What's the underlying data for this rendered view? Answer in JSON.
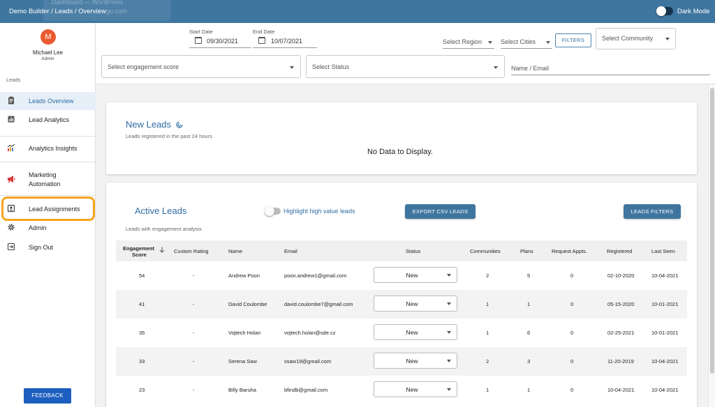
{
  "topbar": {
    "breadcrumb": "Demo Builder  /  Leads / Overview",
    "ghost_tab_title": "Dashboard — WordPress",
    "ghost_tab_url": "go.com",
    "dark_mode_label": "Dark Mode"
  },
  "user": {
    "initial": "M",
    "name": "Michael Lee",
    "role": "Admin"
  },
  "sidebar": {
    "section_label": "Leads",
    "items": [
      {
        "label": "Leads Overview",
        "icon": "clipboard-icon"
      },
      {
        "label": "Lead Analytics",
        "icon": "bar-chart-icon"
      },
      {
        "label": "Analytics Insights",
        "icon": "insights-chart-icon"
      },
      {
        "label": "Marketing",
        "label2": "Automation",
        "icon": "megaphone-icon"
      },
      {
        "label": "Lead Assignments",
        "icon": "assignment-icon"
      },
      {
        "label": "Admin",
        "icon": "gear-icon"
      },
      {
        "label": "Sign Out",
        "icon": "sign-out-icon"
      }
    ],
    "feedback_label": "FEEDBACK"
  },
  "filters": {
    "start_date_label": "Start Date",
    "start_date": "09/30/2021",
    "end_date_label": "End Date",
    "end_date": "10/07/2021",
    "region_placeholder": "Select Region",
    "cities_placeholder": "Select Cities",
    "filters_button": "FILTERS",
    "community_placeholder": "Select Community",
    "engagement_placeholder": "Select engagement score",
    "status_placeholder": "Select Status",
    "name_email_placeholder": "Name / Email"
  },
  "new_leads": {
    "title": "New Leads",
    "subtitle": "Leads registered in the past 24 hours",
    "empty_text": "No Data to Display."
  },
  "active_leads": {
    "title": "Active Leads",
    "subtitle": "Leads with engagement analysis",
    "highlight_label": "Highlight high value leads",
    "export_button": "EXPORT CSV LEADS",
    "filters_button": "LEADS FILTERS",
    "columns": {
      "engagement": "Engagement",
      "engagement2": "Score",
      "rating": "Custom Rating",
      "name": "Name",
      "email": "Email",
      "status": "Status",
      "communities": "Communities",
      "plans": "Plans",
      "appts": "Request Appts.",
      "registered": "Registered",
      "last_seen": "Last Seen"
    },
    "rows": [
      {
        "score": "54",
        "rating": "-",
        "name": "Andrew Poon",
        "email": "poon.andrew1@gmail.com",
        "status": "New",
        "communities": "2",
        "plans": "5",
        "appts": "0",
        "registered": "02-10-2020",
        "last_seen": "10-04-2021"
      },
      {
        "score": "41",
        "rating": "-",
        "name": "David Coulombe",
        "email": "david.coulombe7@gmail.com",
        "status": "New",
        "communities": "1",
        "plans": "1",
        "appts": "0",
        "registered": "05-15-2020",
        "last_seen": "10-01-2021"
      },
      {
        "score": "35",
        "rating": "-",
        "name": "Vojtech Holan",
        "email": "vojtech.holan@sde.cz",
        "status": "New",
        "communities": "1",
        "plans": "6",
        "appts": "0",
        "registered": "02-25-2021",
        "last_seen": "10-01-2021"
      },
      {
        "score": "33",
        "rating": "-",
        "name": "Serena Saw",
        "email": "ssaw19@gmail.com",
        "status": "New",
        "communities": "2",
        "plans": "3",
        "appts": "0",
        "registered": "11-20-2019",
        "last_seen": "10-04-2021"
      },
      {
        "score": "23",
        "rating": "-",
        "name": "Billy Baruha",
        "email": "bfindb@gmail.com",
        "status": "New",
        "communities": "1",
        "plans": "1",
        "appts": "0",
        "registered": "10-04-2021",
        "last_seen": "10-04-2021"
      }
    ]
  },
  "colors": {
    "primary": "#3f76a0",
    "accent_text": "#2f6da3",
    "avatar": "#ea5a2f",
    "highlight_ring": "#f4a61e",
    "feedback": "#1c5fbf"
  }
}
